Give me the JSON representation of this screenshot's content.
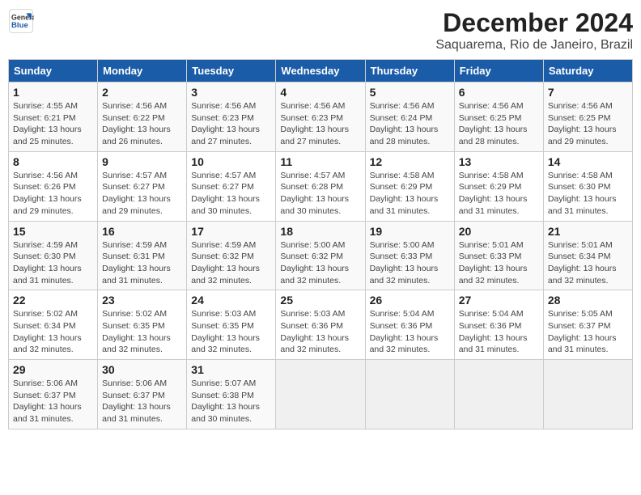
{
  "header": {
    "logo_line1": "General",
    "logo_line2": "Blue",
    "title": "December 2024",
    "subtitle": "Saquarema, Rio de Janeiro, Brazil"
  },
  "weekdays": [
    "Sunday",
    "Monday",
    "Tuesday",
    "Wednesday",
    "Thursday",
    "Friday",
    "Saturday"
  ],
  "weeks": [
    [
      {
        "day": "1",
        "info": "Sunrise: 4:55 AM\nSunset: 6:21 PM\nDaylight: 13 hours\nand 25 minutes."
      },
      {
        "day": "2",
        "info": "Sunrise: 4:56 AM\nSunset: 6:22 PM\nDaylight: 13 hours\nand 26 minutes."
      },
      {
        "day": "3",
        "info": "Sunrise: 4:56 AM\nSunset: 6:23 PM\nDaylight: 13 hours\nand 27 minutes."
      },
      {
        "day": "4",
        "info": "Sunrise: 4:56 AM\nSunset: 6:23 PM\nDaylight: 13 hours\nand 27 minutes."
      },
      {
        "day": "5",
        "info": "Sunrise: 4:56 AM\nSunset: 6:24 PM\nDaylight: 13 hours\nand 28 minutes."
      },
      {
        "day": "6",
        "info": "Sunrise: 4:56 AM\nSunset: 6:25 PM\nDaylight: 13 hours\nand 28 minutes."
      },
      {
        "day": "7",
        "info": "Sunrise: 4:56 AM\nSunset: 6:25 PM\nDaylight: 13 hours\nand 29 minutes."
      }
    ],
    [
      {
        "day": "8",
        "info": "Sunrise: 4:56 AM\nSunset: 6:26 PM\nDaylight: 13 hours\nand 29 minutes."
      },
      {
        "day": "9",
        "info": "Sunrise: 4:57 AM\nSunset: 6:27 PM\nDaylight: 13 hours\nand 29 minutes."
      },
      {
        "day": "10",
        "info": "Sunrise: 4:57 AM\nSunset: 6:27 PM\nDaylight: 13 hours\nand 30 minutes."
      },
      {
        "day": "11",
        "info": "Sunrise: 4:57 AM\nSunset: 6:28 PM\nDaylight: 13 hours\nand 30 minutes."
      },
      {
        "day": "12",
        "info": "Sunrise: 4:58 AM\nSunset: 6:29 PM\nDaylight: 13 hours\nand 31 minutes."
      },
      {
        "day": "13",
        "info": "Sunrise: 4:58 AM\nSunset: 6:29 PM\nDaylight: 13 hours\nand 31 minutes."
      },
      {
        "day": "14",
        "info": "Sunrise: 4:58 AM\nSunset: 6:30 PM\nDaylight: 13 hours\nand 31 minutes."
      }
    ],
    [
      {
        "day": "15",
        "info": "Sunrise: 4:59 AM\nSunset: 6:30 PM\nDaylight: 13 hours\nand 31 minutes."
      },
      {
        "day": "16",
        "info": "Sunrise: 4:59 AM\nSunset: 6:31 PM\nDaylight: 13 hours\nand 31 minutes."
      },
      {
        "day": "17",
        "info": "Sunrise: 4:59 AM\nSunset: 6:32 PM\nDaylight: 13 hours\nand 32 minutes."
      },
      {
        "day": "18",
        "info": "Sunrise: 5:00 AM\nSunset: 6:32 PM\nDaylight: 13 hours\nand 32 minutes."
      },
      {
        "day": "19",
        "info": "Sunrise: 5:00 AM\nSunset: 6:33 PM\nDaylight: 13 hours\nand 32 minutes."
      },
      {
        "day": "20",
        "info": "Sunrise: 5:01 AM\nSunset: 6:33 PM\nDaylight: 13 hours\nand 32 minutes."
      },
      {
        "day": "21",
        "info": "Sunrise: 5:01 AM\nSunset: 6:34 PM\nDaylight: 13 hours\nand 32 minutes."
      }
    ],
    [
      {
        "day": "22",
        "info": "Sunrise: 5:02 AM\nSunset: 6:34 PM\nDaylight: 13 hours\nand 32 minutes."
      },
      {
        "day": "23",
        "info": "Sunrise: 5:02 AM\nSunset: 6:35 PM\nDaylight: 13 hours\nand 32 minutes."
      },
      {
        "day": "24",
        "info": "Sunrise: 5:03 AM\nSunset: 6:35 PM\nDaylight: 13 hours\nand 32 minutes."
      },
      {
        "day": "25",
        "info": "Sunrise: 5:03 AM\nSunset: 6:36 PM\nDaylight: 13 hours\nand 32 minutes."
      },
      {
        "day": "26",
        "info": "Sunrise: 5:04 AM\nSunset: 6:36 PM\nDaylight: 13 hours\nand 32 minutes."
      },
      {
        "day": "27",
        "info": "Sunrise: 5:04 AM\nSunset: 6:36 PM\nDaylight: 13 hours\nand 31 minutes."
      },
      {
        "day": "28",
        "info": "Sunrise: 5:05 AM\nSunset: 6:37 PM\nDaylight: 13 hours\nand 31 minutes."
      }
    ],
    [
      {
        "day": "29",
        "info": "Sunrise: 5:06 AM\nSunset: 6:37 PM\nDaylight: 13 hours\nand 31 minutes."
      },
      {
        "day": "30",
        "info": "Sunrise: 5:06 AM\nSunset: 6:37 PM\nDaylight: 13 hours\nand 31 minutes."
      },
      {
        "day": "31",
        "info": "Sunrise: 5:07 AM\nSunset: 6:38 PM\nDaylight: 13 hours\nand 30 minutes."
      },
      {
        "day": "",
        "info": ""
      },
      {
        "day": "",
        "info": ""
      },
      {
        "day": "",
        "info": ""
      },
      {
        "day": "",
        "info": ""
      }
    ]
  ]
}
